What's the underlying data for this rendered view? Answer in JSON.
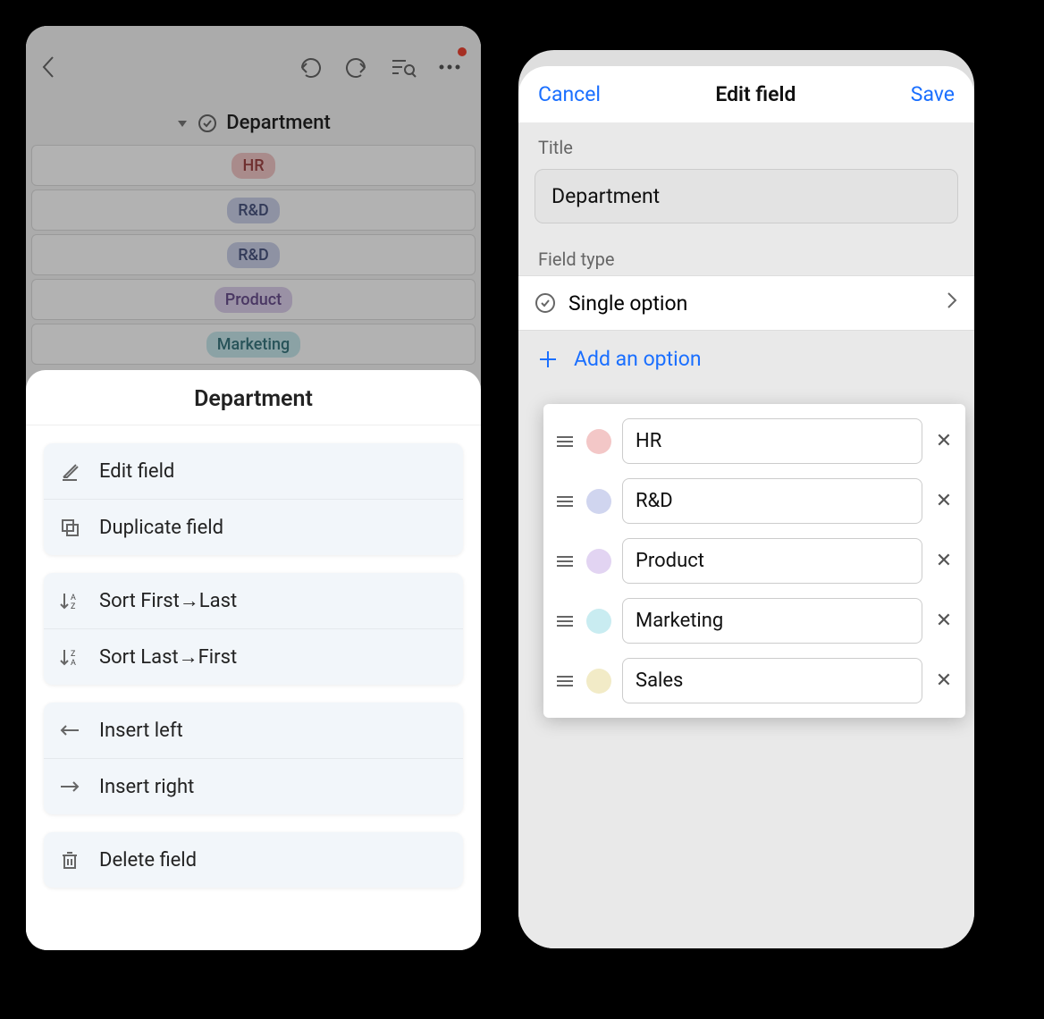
{
  "left": {
    "column_name": "Department",
    "tags": [
      {
        "label": "HR",
        "cls": "tag-hr"
      },
      {
        "label": "R&D",
        "cls": "tag-rd"
      },
      {
        "label": "R&D",
        "cls": "tag-rd"
      },
      {
        "label": "Product",
        "cls": "tag-product"
      },
      {
        "label": "Marketing",
        "cls": "tag-marketing"
      }
    ],
    "sheet_title": "Department",
    "menu": {
      "edit_field": "Edit field",
      "duplicate_field": "Duplicate field",
      "sort_first_last": "Sort First→Last",
      "sort_last_first": "Sort Last→First",
      "insert_left": "Insert left",
      "insert_right": "Insert right",
      "delete_field": "Delete field"
    }
  },
  "right": {
    "cancel": "Cancel",
    "save": "Save",
    "header_title": "Edit field",
    "title_label": "Title",
    "title_value": "Department",
    "field_type_label": "Field type",
    "field_type_value": "Single option",
    "add_option": "Add an option",
    "options": [
      {
        "label": "HR",
        "dot": "dot-hr"
      },
      {
        "label": "R&D",
        "dot": "dot-rd"
      },
      {
        "label": "Product",
        "dot": "dot-product"
      },
      {
        "label": "Marketing",
        "dot": "dot-marketing"
      },
      {
        "label": "Sales",
        "dot": "dot-sales"
      }
    ]
  }
}
